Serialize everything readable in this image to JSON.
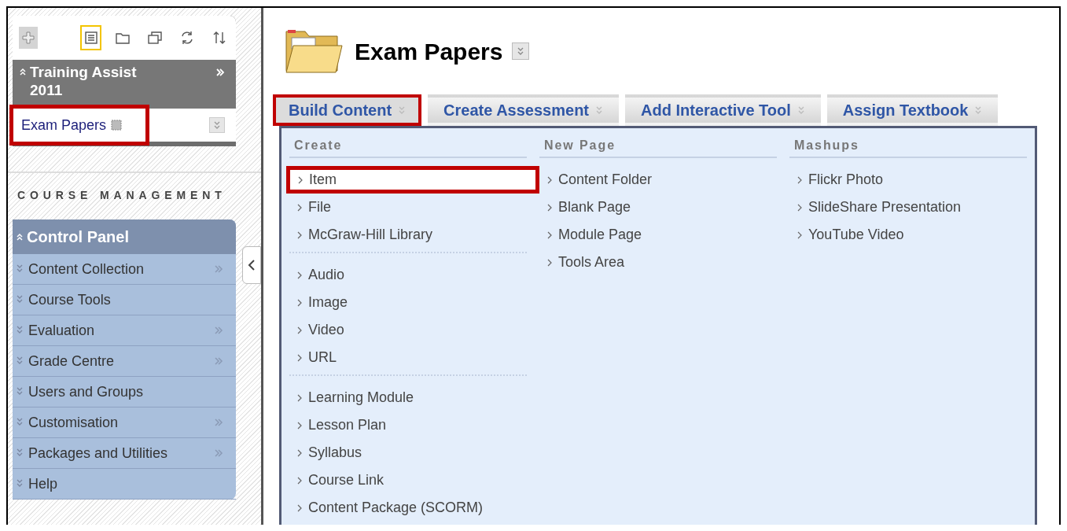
{
  "toolbar": {
    "views": [
      {
        "kind": "list",
        "selected": true
      },
      {
        "kind": "folder",
        "selected": false
      },
      {
        "kind": "windows",
        "selected": false
      },
      {
        "kind": "refresh",
        "selected": false
      },
      {
        "kind": "sort",
        "selected": false
      }
    ]
  },
  "course": {
    "title": "Training Assist 2011",
    "items": [
      {
        "label": "Exam Papers",
        "highlighted": true
      }
    ]
  },
  "course_management": {
    "heading": "COURSE MANAGEMENT"
  },
  "control_panel": {
    "title": "Control Panel",
    "expanded": true,
    "items": [
      {
        "label": "Content Collection",
        "has_submenu": true
      },
      {
        "label": "Course Tools",
        "has_submenu": false
      },
      {
        "label": "Evaluation",
        "has_submenu": true
      },
      {
        "label": "Grade Centre",
        "has_submenu": true
      },
      {
        "label": "Users and Groups",
        "has_submenu": false
      },
      {
        "label": "Customisation",
        "has_submenu": true
      },
      {
        "label": "Packages and Utilities",
        "has_submenu": true
      },
      {
        "label": "Help",
        "has_submenu": false
      }
    ]
  },
  "page": {
    "title": "Exam Papers",
    "tabs": [
      {
        "label": "Build Content",
        "selected": true,
        "highlighted": true
      },
      {
        "label": "Create Assessment",
        "selected": false,
        "highlighted": false
      },
      {
        "label": "Add Interactive Tool",
        "selected": false,
        "highlighted": false
      },
      {
        "label": "Assign Textbook",
        "selected": false,
        "highlighted": false
      }
    ],
    "menu_columns": [
      {
        "heading": "Create",
        "groups": [
          [
            {
              "label": "Item",
              "highlighted": true
            },
            {
              "label": "File",
              "highlighted": false
            },
            {
              "label": "McGraw-Hill Library",
              "highlighted": false
            }
          ],
          [
            {
              "label": "Audio",
              "highlighted": false
            },
            {
              "label": "Image",
              "highlighted": false
            },
            {
              "label": "Video",
              "highlighted": false
            },
            {
              "label": "URL",
              "highlighted": false
            }
          ],
          [
            {
              "label": "Learning Module",
              "highlighted": false
            },
            {
              "label": "Lesson Plan",
              "highlighted": false
            },
            {
              "label": "Syllabus",
              "highlighted": false
            },
            {
              "label": "Course Link",
              "highlighted": false
            },
            {
              "label": "Content Package (SCORM)",
              "highlighted": false
            }
          ]
        ]
      },
      {
        "heading": "New Page",
        "groups": [
          [
            {
              "label": "Content Folder",
              "highlighted": false
            },
            {
              "label": "Blank Page",
              "highlighted": false
            },
            {
              "label": "Module Page",
              "highlighted": false
            },
            {
              "label": "Tools Area",
              "highlighted": false
            }
          ]
        ]
      },
      {
        "heading": "Mashups",
        "groups": [
          [
            {
              "label": "Flickr Photo",
              "highlighted": false
            },
            {
              "label": "SlideShare Presentation",
              "highlighted": false
            },
            {
              "label": "YouTube Video",
              "highlighted": false
            }
          ]
        ]
      }
    ]
  }
}
